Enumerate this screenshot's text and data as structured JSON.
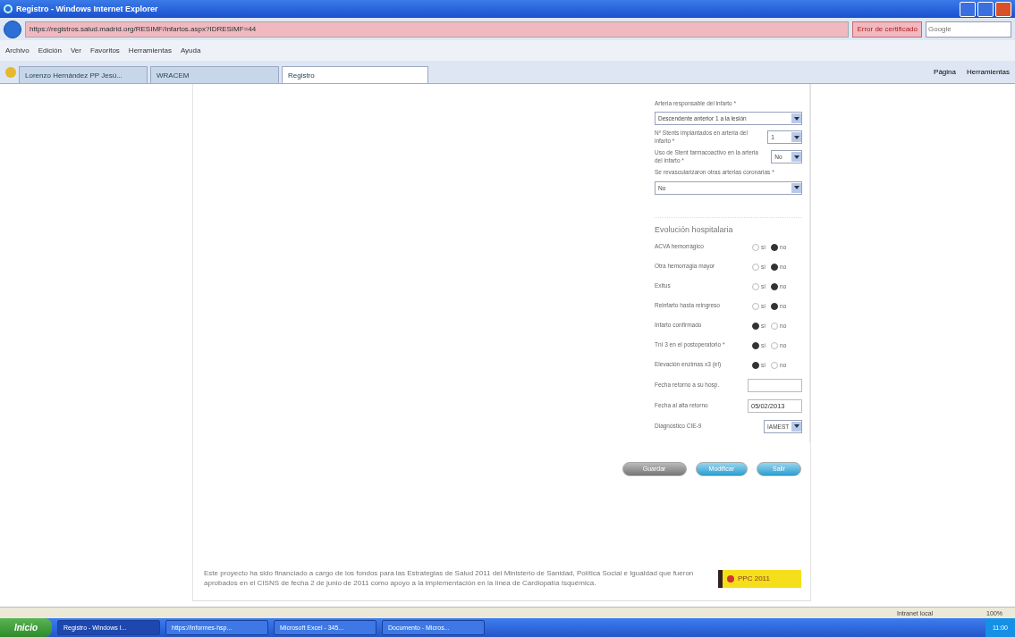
{
  "window": {
    "title": "Registro - Windows Internet Explorer"
  },
  "address_bar": {
    "url": "https://registros.salud.madrid.org/RESIMF/Infartos.aspx?IDRESIMF=44",
    "certificate": "Error de certificado",
    "search_placeholder": "Google"
  },
  "menu": [
    "Archivo",
    "Edición",
    "Ver",
    "Favoritos",
    "Herramientas",
    "Ayuda"
  ],
  "tabs": [
    {
      "label": "Lorenzo Hernández PP Jesú...",
      "selected": false
    },
    {
      "label": "WRACEM",
      "selected": false
    },
    {
      "label": "Registro",
      "selected": true
    }
  ],
  "toolbar_right": [
    "Página",
    "Herramientas"
  ],
  "form": {
    "fields": [
      {
        "kind": "wide_select",
        "label": "Arteria responsable del infarto *",
        "value": "Descendente anterior 1 a la lesión"
      },
      {
        "kind": "small_select",
        "label": "Nº Stents implantados en arteria del infarto *",
        "value": "1"
      },
      {
        "kind": "small_select",
        "label": "Uso de Stent farmacoactivo en la arteria del infarto *",
        "value": "No"
      },
      {
        "kind": "wide_select",
        "label": "Se revascularizaron otras arterias coronarias *",
        "value": "No"
      }
    ],
    "section_title": "Evolución hospitalaria",
    "evolution": [
      {
        "kind": "radio",
        "label": "ACVA hemorrágico",
        "options": [
          {
            "label": "sí",
            "selected": false
          },
          {
            "label": "no",
            "selected": true
          }
        ]
      },
      {
        "kind": "radio",
        "label": "Otra hemorragia mayor",
        "options": [
          {
            "label": "sí",
            "selected": false
          },
          {
            "label": "no",
            "selected": true
          }
        ]
      },
      {
        "kind": "radio",
        "label": "Exitus",
        "options": [
          {
            "label": "sí",
            "selected": false
          },
          {
            "label": "no",
            "selected": true
          }
        ]
      },
      {
        "kind": "radio",
        "label": "Reinfarto hasta reingreso",
        "options": [
          {
            "label": "sí",
            "selected": false
          },
          {
            "label": "no",
            "selected": true
          }
        ]
      },
      {
        "kind": "radio",
        "label": "Infarto confirmado",
        "options": [
          {
            "label": "sí",
            "selected": true
          },
          {
            "label": "no",
            "selected": false
          }
        ]
      },
      {
        "kind": "radio",
        "label": "TnI 3 en el postoperatorio *",
        "options": [
          {
            "label": "sí",
            "selected": true
          },
          {
            "label": "no",
            "selected": false
          }
        ]
      },
      {
        "kind": "radio",
        "label": "Elevación enzimas x3 (el)",
        "options": [
          {
            "label": "sí",
            "selected": true
          },
          {
            "label": "no",
            "selected": false
          }
        ]
      },
      {
        "kind": "date",
        "label": "Fecha retorno a su hosp."
      },
      {
        "kind": "date",
        "label": "Fecha al alta retorno",
        "value": "05/02/2013"
      },
      {
        "kind": "select",
        "label": "Diagnóstico CIE-9",
        "value": "IAMEST"
      }
    ]
  },
  "buttons": [
    {
      "label": "Guardar",
      "kind": "grey"
    },
    {
      "label": "Modificar",
      "kind": "blue"
    },
    {
      "label": "Salir",
      "kind": "blue"
    }
  ],
  "footer": {
    "text": "Este proyecto ha sido financiado a cargo de los fondos para las Estrategias de Salud 2011 del Ministerio de Sanidad, Política Social e Igualdad que fueron aprobados en el CISNS de fecha 2 de junio de 2011 como apoyo a la implementación en la línea de Cardiopatía Isquémica.",
    "logo_text": "PPC 2011"
  },
  "status_bar": {
    "zone": "Intranet local",
    "zoom": "100%"
  },
  "taskbar": {
    "start": "Inicio",
    "items": [
      {
        "label": "Registro - Windows I...",
        "selected": true
      },
      {
        "label": "https://informes-hsp...",
        "selected": false
      },
      {
        "label": "Microsoft Excel - 345...",
        "selected": false
      },
      {
        "label": "Documento - Micros...",
        "selected": false
      }
    ],
    "clock": "11:00"
  }
}
